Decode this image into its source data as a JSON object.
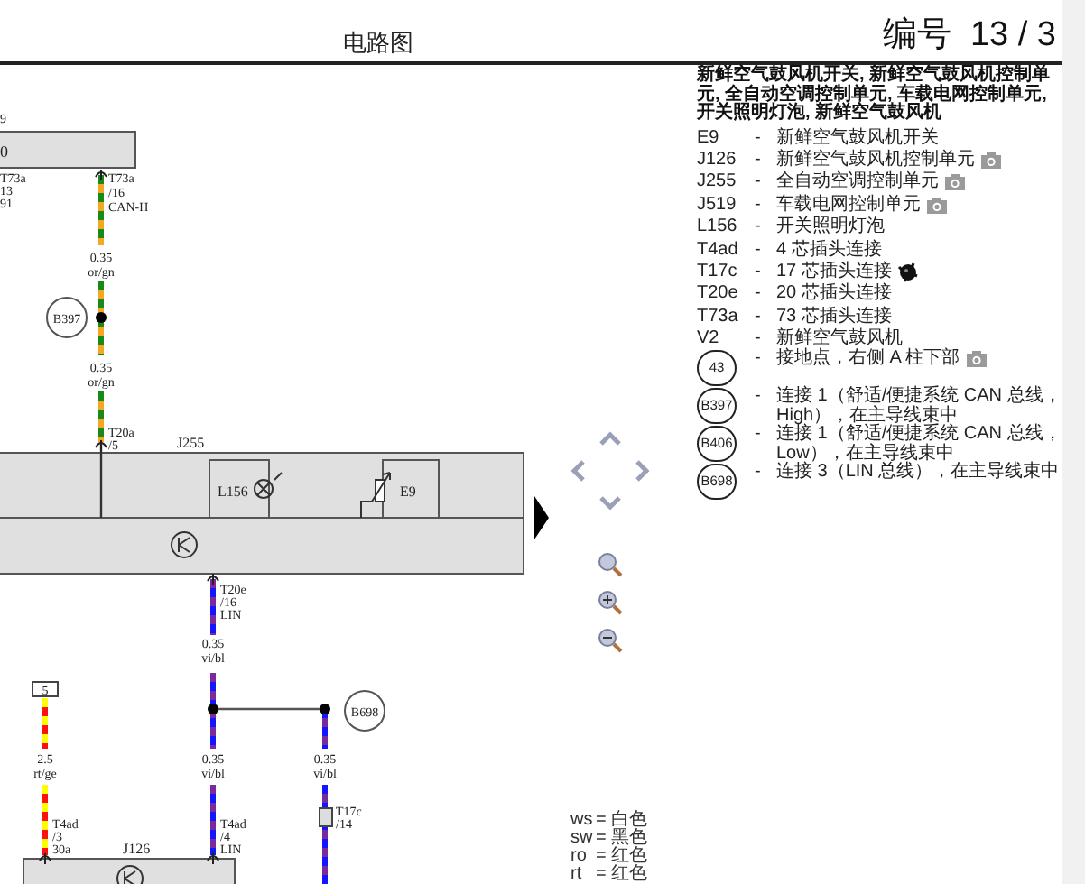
{
  "header": {
    "title": "电路图",
    "doc_number": "编号  13 / 3"
  },
  "diagram": {
    "labels": [
      "9",
      "0",
      "T73a",
      "13",
      "91",
      "T73a",
      "/16",
      "CAN-H",
      "0.35",
      "or/gn",
      "B397",
      "0.35",
      "or/gn",
      "T20a",
      "/5",
      "J255",
      "L156",
      "E9",
      "T20e",
      "/16",
      "LIN",
      "0.35",
      "vi/bl",
      "5",
      "B698",
      "2.5",
      "rt/ge",
      "0.35",
      "vi/bl",
      "0.35",
      "vi/bl",
      "T4ad",
      "/3",
      "30a",
      "T4ad",
      "/4",
      "LIN",
      "T17c",
      "/14",
      "J126"
    ]
  },
  "color_legend": [
    {
      "code": "ws",
      "name": "= 白色"
    },
    {
      "code": "sw",
      "name": "= 黑色"
    },
    {
      "code": "ro",
      "name": "= 红色"
    },
    {
      "code": "rt",
      "name": "= 红色"
    }
  ],
  "legend": {
    "heading": "新鲜空气鼓风机开关, 新鲜空气鼓风机控制单元, 全自动空调控制单元, 车载电网控制单元, 开关照明灯泡, 新鲜空气鼓风机",
    "items": [
      {
        "code": "E9",
        "kind": "code",
        "separator": "-",
        "description": "新鲜空气鼓风机开关"
      },
      {
        "code": "J126",
        "kind": "code_photo",
        "separator": "-",
        "description": "新鲜空气鼓风机控制单元"
      },
      {
        "code": "J255",
        "kind": "code_photo",
        "separator": "-",
        "description": "全自动空调控制单元"
      },
      {
        "code": "J519",
        "kind": "code_photo",
        "separator": "-",
        "description": "车载电网控制单元"
      },
      {
        "code": "L156",
        "kind": "code",
        "separator": "-",
        "description": "开关照明灯泡"
      },
      {
        "code": "T4ad",
        "kind": "code",
        "separator": "-",
        "description": "4 芯插头连接"
      },
      {
        "code": "T17c",
        "kind": "code_plug",
        "separator": "-",
        "description": "17 芯插头连接"
      },
      {
        "code": "T20e",
        "kind": "code",
        "separator": "-",
        "description": "20 芯插头连接"
      },
      {
        "code": "T73a",
        "kind": "code",
        "separator": "-",
        "description": "73 芯插头连接"
      },
      {
        "code": "V2",
        "kind": "code",
        "separator": "-",
        "description": "新鲜空气鼓风机"
      },
      {
        "code": "43",
        "kind": "circle_photo",
        "separator": "-",
        "description": "接地点，右侧 A 柱下部"
      },
      {
        "code": "B397",
        "kind": "circle",
        "separator": "-",
        "description": "连接 1（舒适/便捷系统 CAN 总线，High），在主导线束中"
      },
      {
        "code": "B406",
        "kind": "circle",
        "separator": "-",
        "description": "连接 1（舒适/便捷系统 CAN 总线，Low），在主导线束中"
      },
      {
        "code": "B698",
        "kind": "circle",
        "separator": "-",
        "description": "连接 3（LIN 总线），在主导线束中"
      }
    ]
  }
}
